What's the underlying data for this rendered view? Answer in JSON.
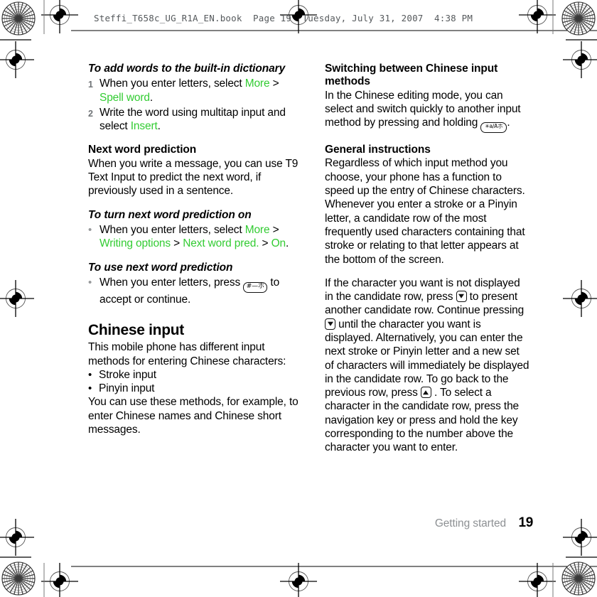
{
  "print_slug": "Steffi_T658c_UG_R1A_EN.book  Page 19  Tuesday, July 31, 2007  4:38 PM",
  "colors": {
    "menu_green": "#33cc33",
    "step_number_gray": "#6f7376",
    "footer_gray": "#8d9093",
    "body_black": "#000000"
  },
  "left_column": {
    "proc_dictionary": {
      "heading": "To add words to the built-in dictionary",
      "steps": [
        {
          "number": "1",
          "parts": [
            {
              "text": "When you enter letters, select ",
              "style": "plain"
            },
            {
              "text": "More",
              "style": "menu"
            },
            {
              "text": " > ",
              "style": "plain"
            },
            {
              "text": "Spell word",
              "style": "menu"
            },
            {
              "text": ".",
              "style": "plain"
            }
          ]
        },
        {
          "number": "2",
          "parts": [
            {
              "text": "Write the word using multitap input and select ",
              "style": "plain"
            },
            {
              "text": "Insert",
              "style": "menu"
            },
            {
              "text": ".",
              "style": "plain"
            }
          ]
        }
      ]
    },
    "next_word_prediction": {
      "heading": "Next word prediction",
      "body": "When you write a message, you can use T9 Text Input to predict the next word, if previously used in a sentence."
    },
    "proc_turn_on": {
      "heading": "To turn next word prediction on",
      "bullet_parts": [
        {
          "text": "When you enter letters, select ",
          "style": "plain"
        },
        {
          "text": "More",
          "style": "menu"
        },
        {
          "text": " > ",
          "style": "plain"
        },
        {
          "text": "Writing options",
          "style": "menu"
        },
        {
          "text": " > ",
          "style": "plain"
        },
        {
          "text": "Next word pred.",
          "style": "menu"
        },
        {
          "text": " > ",
          "style": "plain"
        },
        {
          "text": "On",
          "style": "menu"
        },
        {
          "text": ".",
          "style": "plain"
        }
      ]
    },
    "proc_use": {
      "heading": "To use next word prediction",
      "bullet_prefix": "When you enter letters, press ",
      "key_label": "#—ホ",
      "bullet_suffix": " to accept or continue."
    },
    "chinese_input": {
      "heading": "Chinese input",
      "intro": "This mobile phone has different input methods for entering Chinese characters:",
      "bullets": [
        "Stroke input",
        "Pinyin input"
      ],
      "outro": "You can use these methods, for example, to enter Chinese names and Chinese short messages."
    }
  },
  "right_column": {
    "switching": {
      "heading": "Switching between Chinese input methods",
      "body_prefix": "In the Chinese editing mode, you can select and switch quickly to another input method by pressing and holding ",
      "key_label": "✳a/Aホ",
      "body_suffix": "."
    },
    "general": {
      "heading": "General instructions",
      "body": "Regardless of which input method you choose, your phone has a function to speed up the entry of Chinese characters. Whenever you enter a stroke or a Pinyin letter, a candidate row of the most frequently used characters containing that stroke or relating to that letter appears at the bottom of the screen."
    },
    "candidate_row": {
      "seg_1": "If the character you want is not displayed in the candidate row, press ",
      "seg_2": " to present another candidate row. Continue pressing ",
      "seg_3": " until the character you want is displayed. Alternatively, you can enter the next stroke or Pinyin letter and a new set of characters will immediately be displayed in the candidate row. To go back to the previous row, press ",
      "seg_4": " . To select a character in the candidate row, press the navigation key or press and hold the key corresponding to the number above the character you want to enter."
    }
  },
  "footer": {
    "section": "Getting started",
    "page_number": "19"
  }
}
